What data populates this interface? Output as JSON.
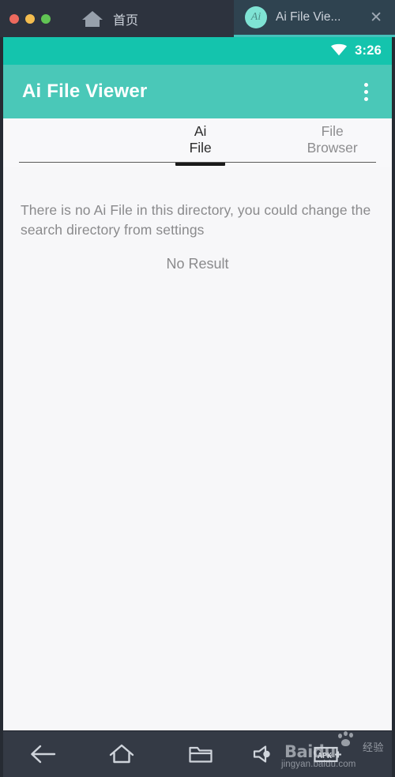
{
  "browser": {
    "window_buttons": [
      "close",
      "minimize",
      "maximize"
    ],
    "tabs": [
      {
        "title": "首页",
        "icon": "home-icon",
        "active": false
      },
      {
        "title": "Ai File Vie...",
        "icon": "app-icon-ai",
        "favicon_text": "Ai",
        "active": true,
        "close_label": "✕"
      }
    ]
  },
  "phone": {
    "status_bar": {
      "wifi_icon": "wifi-icon",
      "time": "3:26",
      "background": "#14c4ad"
    },
    "app_bar": {
      "title": "Ai File Viewer",
      "overflow_icon": "more-vert-icon",
      "background": "#4ac8b8"
    },
    "tabs": [
      {
        "label": "Ai File",
        "active": true
      },
      {
        "label": "File Browser",
        "active": false
      }
    ],
    "content": {
      "empty_message": "There is no Ai File in this directory, you could change the search directory from settings",
      "no_result": "No Result"
    },
    "nav_bar": {
      "buttons": [
        {
          "name": "back",
          "icon": "back-arrow-icon"
        },
        {
          "name": "home",
          "icon": "home-outline-icon"
        },
        {
          "name": "recent-files",
          "icon": "folder-icon"
        },
        {
          "name": "volume",
          "icon": "speaker-icon"
        },
        {
          "name": "apk-install",
          "icon": "apk-plus-icon",
          "label": "APK"
        }
      ]
    }
  },
  "watermark": {
    "brand": "Baidu",
    "cn_label": "经验",
    "url": "jingyan.baidu.com"
  },
  "colors": {
    "status_teal": "#14c4ad",
    "appbar_teal": "#4ac8b8",
    "chrome_dark": "#2d333e",
    "active_tab": "#2f4350",
    "body_bg": "#f7f7f9",
    "navbar": "#343a45"
  }
}
